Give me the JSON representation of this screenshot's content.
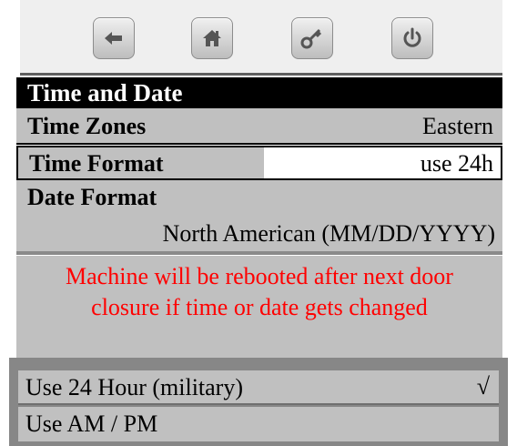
{
  "toolbar": {
    "buttons": [
      {
        "icon": "back-arrow-icon"
      },
      {
        "icon": "home-icon"
      },
      {
        "icon": "key-icon"
      },
      {
        "icon": "power-icon"
      }
    ]
  },
  "header": {
    "title": "Time and Date"
  },
  "settings": {
    "time_zones": {
      "label": "Time Zones",
      "value": "Eastern"
    },
    "time_format": {
      "label": "Time Format",
      "value": "use 24h"
    },
    "date_format": {
      "label": "Date Format",
      "value": "North American (MM/DD/YYYY)"
    }
  },
  "warning": {
    "text": "Machine will be rebooted after next door closure if time or date gets changed",
    "color": "#ff0000"
  },
  "options": {
    "items": [
      {
        "label": "Use 24 Hour (military)",
        "selected_mark": "√"
      },
      {
        "label": "Use AM / PM",
        "selected_mark": ""
      }
    ]
  }
}
